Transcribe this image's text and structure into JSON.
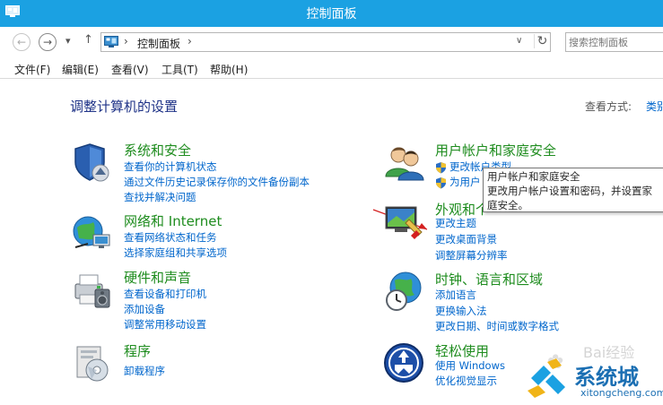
{
  "window": {
    "title": "控制面板"
  },
  "nav": {
    "back_glyph": "←",
    "forward_glyph": "→",
    "recent_glyph": "▾",
    "up_glyph": "↑",
    "breadcrumb_sep": "›",
    "breadcrumb": "控制面板",
    "breadcrumb_arrow": "›",
    "dropdown_glyph": "∨",
    "refresh_glyph": "↻",
    "search_placeholder": "搜索控制面板"
  },
  "menu": [
    "文件(F)",
    "编辑(E)",
    "查看(V)",
    "工具(T)",
    "帮助(H)"
  ],
  "page": {
    "title": "调整计算机的设置",
    "view_by_label": "查看方式:",
    "view_by_value": "类别"
  },
  "categories": {
    "system": {
      "icon": "shield-icon",
      "title": "系统和安全",
      "links": [
        "查看你的计算机状态",
        "通过文件历史记录保存你的文件备份副本",
        "查找并解决问题"
      ]
    },
    "network": {
      "icon": "network-globe-icon",
      "title": "网络和 Internet",
      "links": [
        "查看网络状态和任务",
        "选择家庭组和共享选项"
      ]
    },
    "hardware": {
      "icon": "printer-icon",
      "title": "硬件和声音",
      "links": [
        "查看设备和打印机",
        "添加设备",
        "调整常用移动设置"
      ]
    },
    "programs": {
      "icon": "programs-icon",
      "title": "程序",
      "links": [
        "卸载程序"
      ]
    },
    "users": {
      "icon": "users-icon",
      "title": "用户帐户和家庭安全",
      "links": [
        "更改帐户类型",
        "为用户"
      ]
    },
    "appearance": {
      "icon": "appearance-icon",
      "title": "外观和个",
      "links": [
        "更改主题",
        "更改桌面背景",
        "调整屏幕分辨率"
      ]
    },
    "clock": {
      "icon": "clock-globe-icon",
      "title": "时钟、语言和区域",
      "links": [
        "添加语言",
        "更换输入法",
        "更改日期、时间或数字格式"
      ]
    },
    "ease": {
      "icon": "ease-of-access-icon",
      "title": "轻松使用",
      "links": [
        "使用 Windows",
        "优化视觉显示"
      ]
    }
  },
  "tooltip": {
    "line1": "用户帐户和家庭安全",
    "line2": "更改用户帐户设置和密码，并设置家",
    "line3": "庭安全。"
  },
  "watermark": {
    "brand": "系统城",
    "url": "xitongcheng.com",
    "bg": "Bai经验"
  },
  "colors": {
    "titlebar": "#1ba1e2",
    "category_title": "#1e8c1e",
    "link": "#0066cc",
    "page_title": "#1e3287",
    "annotation_arrow": "#d42020"
  }
}
